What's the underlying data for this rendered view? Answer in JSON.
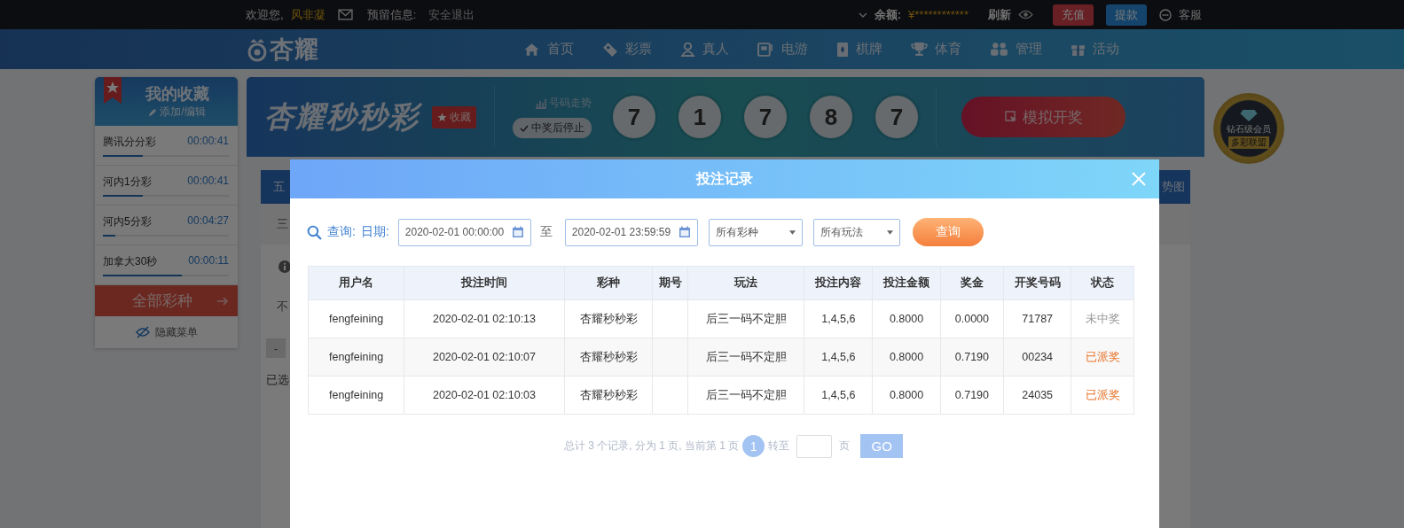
{
  "top_bar": {
    "welcome": "欢迎您,",
    "user": "风非凝",
    "reserved": "预留信息:",
    "logout": "安全退出",
    "balance_label": "余额:",
    "balance": "¥************",
    "refresh": "刷新",
    "recharge": "充值",
    "withdraw": "提款",
    "service": "客服"
  },
  "nav": {
    "logo": "杏耀",
    "items": [
      {
        "label": "首页",
        "kind": "home"
      },
      {
        "label": "彩票",
        "kind": "ticket"
      },
      {
        "label": "真人",
        "kind": "person"
      },
      {
        "label": "电游",
        "kind": "slot"
      },
      {
        "label": "棋牌",
        "kind": "cards"
      },
      {
        "label": "体育",
        "kind": "trophy"
      },
      {
        "label": "管理",
        "kind": "people"
      },
      {
        "label": "活动",
        "kind": "gift"
      }
    ]
  },
  "favorites": {
    "title": "我的收藏",
    "edit": "添加/编辑",
    "items": [
      {
        "name": "腾讯分分彩",
        "time": "00:00:41",
        "level": 0.32
      },
      {
        "name": "河内1分彩",
        "time": "00:00:41",
        "level": 0.32
      },
      {
        "name": "河内5分彩",
        "time": "00:04:27",
        "level": 0.1
      },
      {
        "name": "加拿大30秒",
        "time": "00:00:11",
        "level": 0.63
      }
    ],
    "all_button": "全部彩种",
    "hide": "隐藏菜单"
  },
  "banner": {
    "title": "杏耀秒秒彩",
    "favorite": "收藏",
    "trend": "号码走势",
    "stop": {
      "label": "中奖后停止",
      "checked": true
    },
    "balls": [
      "7",
      "1",
      "7",
      "8",
      "7"
    ],
    "simulate": "模拟开奖"
  },
  "badge": {
    "text": "钻石级会员",
    "sub": "多彩联盟"
  },
  "behind": {
    "tab_left": "五",
    "tab_right": "势图",
    "row_1": "三",
    "row_2": "不",
    "minus": "-",
    "selected": "已选"
  },
  "modal": {
    "title": "投注记录",
    "query_label": "查询:",
    "date_label": "日期:",
    "start": "2020-02-01 00:00:00",
    "separator": "至",
    "end": "2020-02-01 23:59:59",
    "lottery_select": "所有彩种",
    "play_select": "所有玩法",
    "query_button": "查询",
    "table": {
      "columns": [
        "用户名",
        "投注时间",
        "彩种",
        "期号",
        "玩法",
        "投注内容",
        "投注金额",
        "奖金",
        "开奖号码",
        "状态"
      ],
      "rows": [
        {
          "cells": [
            "fengfeining",
            "2020-02-01 02:10:13",
            "杏耀秒秒彩",
            "",
            "后三一码不定胆",
            "1,4,5,6",
            "0.8000",
            "0.0000",
            "71787"
          ],
          "status": {
            "text": "未中奖",
            "kind": "lost"
          }
        },
        {
          "cells": [
            "fengfeining",
            "2020-02-01 02:10:07",
            "杏耀秒秒彩",
            "",
            "后三一码不定胆",
            "1,4,5,6",
            "0.8000",
            "0.7190",
            "00234"
          ],
          "status": {
            "text": "已派奖",
            "kind": "paid"
          }
        },
        {
          "cells": [
            "fengfeining",
            "2020-02-01 02:10:03",
            "杏耀秒秒彩",
            "",
            "后三一码不定胆",
            "1,4,5,6",
            "0.8000",
            "0.7190",
            "24035"
          ],
          "status": {
            "text": "已派奖",
            "kind": "paid"
          }
        }
      ]
    },
    "pagination": {
      "summary": "总计 3 个记录, 分为 1 页, 当前第 1 页",
      "current": "1",
      "goto": "转至",
      "unit": "页",
      "go": "GO"
    }
  }
}
